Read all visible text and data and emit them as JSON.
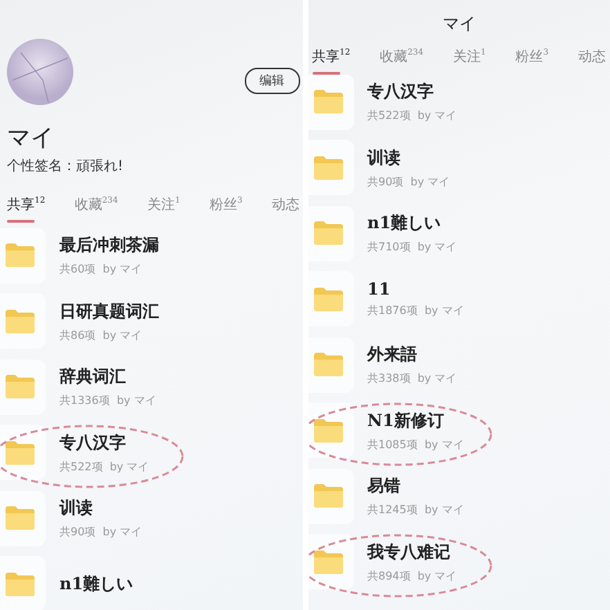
{
  "left_screen": {
    "profile": {
      "name": "マイ",
      "signature": "个性签名：頑張れ!",
      "edit_button": "编辑"
    },
    "tabs": [
      {
        "label": "共享",
        "count": "12",
        "selected": true
      },
      {
        "label": "收藏",
        "count": "234",
        "selected": false
      },
      {
        "label": "关注",
        "count": "1",
        "selected": false
      },
      {
        "label": "粉丝",
        "count": "3",
        "selected": false
      },
      {
        "label": "动态",
        "selected": false
      }
    ],
    "folders": [
      {
        "title": "最后冲刺茶漏",
        "meta": "共60项  by マイ",
        "circled": false
      },
      {
        "title": "日研真题词汇",
        "meta": "共86项  by マイ",
        "circled": false
      },
      {
        "title": "辞典词汇",
        "meta": "共1336项  by マイ",
        "circled": false
      },
      {
        "title": "专八汉字",
        "meta": "共522项  by マイ",
        "circled": true
      },
      {
        "title": "训读",
        "meta": "共90项  by マイ",
        "circled": false
      },
      {
        "title": "n1難しい",
        "circled": false
      }
    ]
  },
  "right_screen": {
    "title": "マイ",
    "tabs": [
      {
        "label": "共享",
        "count": "12",
        "selected": true
      },
      {
        "label": "收藏",
        "count": "234",
        "selected": false
      },
      {
        "label": "关注",
        "count": "1",
        "selected": false
      },
      {
        "label": "粉丝",
        "count": "3",
        "selected": false
      },
      {
        "label": "动态",
        "selected": false
      }
    ],
    "folders": [
      {
        "title": "专八汉字",
        "meta": "共522项  by マイ",
        "circled": false
      },
      {
        "title": "训读",
        "meta": "共90项  by マイ",
        "circled": false
      },
      {
        "title": "n1難しい",
        "meta": "共710项  by マイ",
        "circled": false
      },
      {
        "title": "11",
        "meta": "共1876项  by マイ",
        "circled": false
      },
      {
        "title": "外来語",
        "meta": "共338项  by マイ",
        "circled": false
      },
      {
        "title": "N1新修订",
        "meta": "共1085项  by マイ",
        "circled": true
      },
      {
        "title": "易错",
        "meta": "共1245项  by マイ",
        "circled": false
      },
      {
        "title": "我专八难记",
        "meta": "共894项  by マイ",
        "circled": true
      }
    ]
  }
}
